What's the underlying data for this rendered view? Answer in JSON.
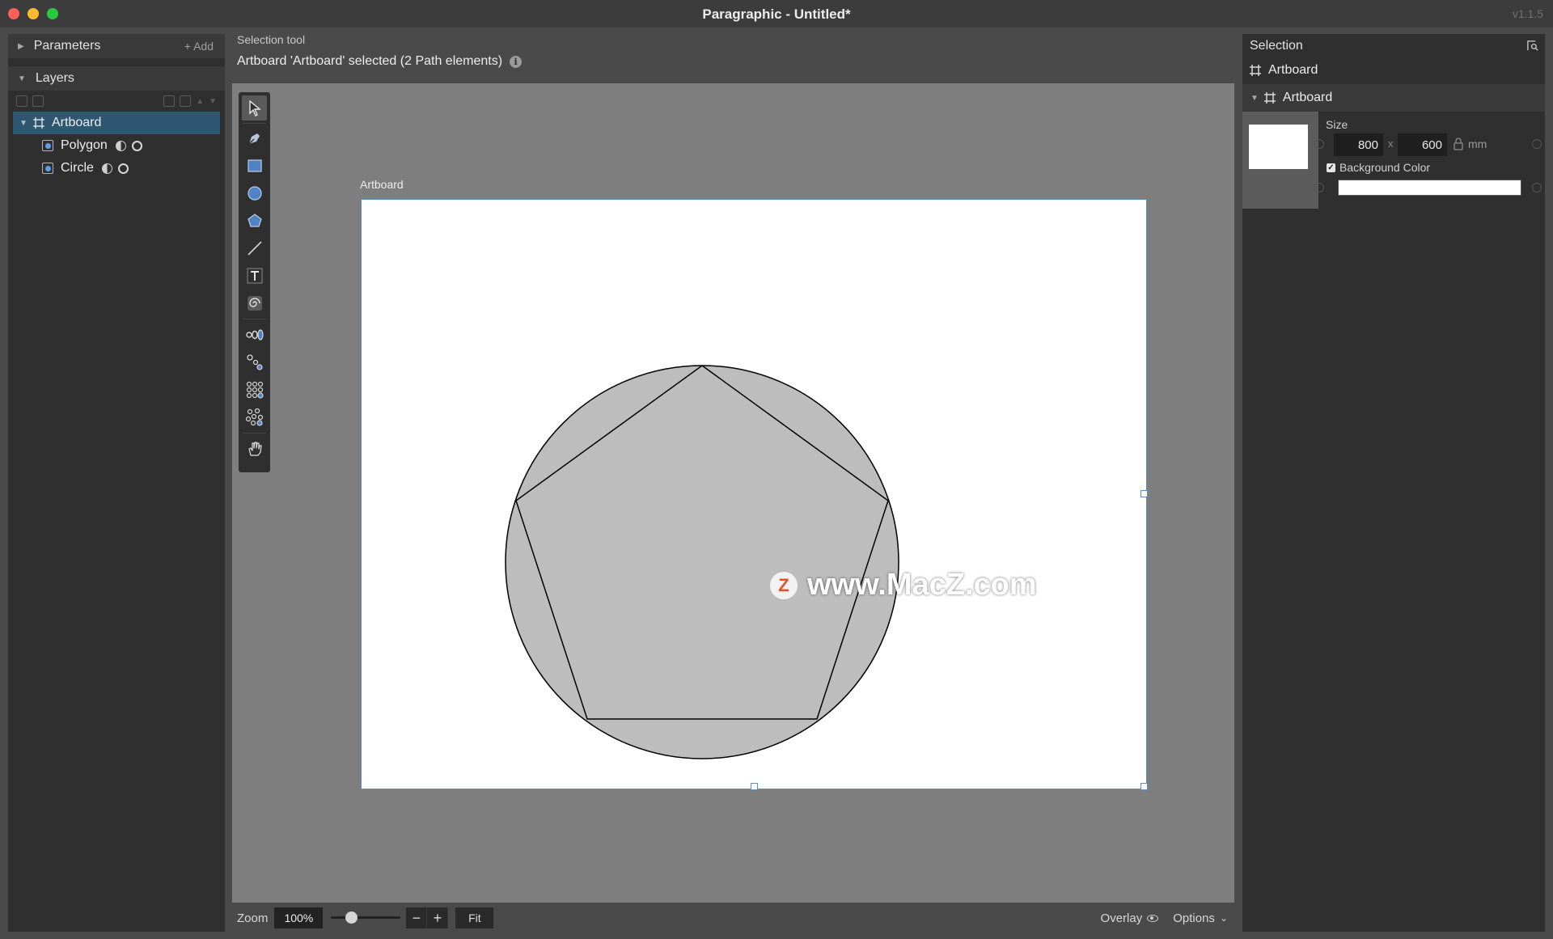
{
  "window": {
    "title": "Paragraphic - Untitled*",
    "version": "v1.1.5"
  },
  "left_panel": {
    "parameters_label": "Parameters",
    "add_label": "+ Add",
    "layers_label": "Layers",
    "layers": [
      {
        "name": "Artboard",
        "type": "artboard",
        "selected": true
      },
      {
        "name": "Polygon",
        "type": "path"
      },
      {
        "name": "Circle",
        "type": "path"
      }
    ]
  },
  "canvas": {
    "tool_hint": "Selection tool",
    "status": "Artboard 'Artboard' selected (2 Path elements)",
    "artboard_label": "Artboard",
    "watermark": "www.MacZ.com",
    "watermark_logo": "Z",
    "shape_fill": "#bdbdbd",
    "shape_stroke": "#000000",
    "tools": [
      "select-tool-icon",
      "pen-tool-icon",
      "rectangle-tool-icon",
      "ellipse-tool-icon",
      "polygon-tool-icon",
      "line-tool-icon",
      "text-tool-icon",
      "spiral-tool-icon",
      "repeat-tool-icon",
      "connect-tool-icon",
      "grid-tool-icon",
      "scatter-tool-icon",
      "hand-tool-icon"
    ]
  },
  "bottom_bar": {
    "zoom_label": "Zoom",
    "zoom_value": "100%",
    "zoom_slider": 0.25,
    "minus": "−",
    "plus": "+",
    "fit": "Fit",
    "overlay": "Overlay",
    "options": "Options"
  },
  "right_panel": {
    "selection_label": "Selection",
    "selected_item": "Artboard",
    "group_label": "Artboard",
    "size_label": "Size",
    "width": "800",
    "x_label": "x",
    "height": "600",
    "unit": "mm",
    "background_label": "Background Color",
    "background_checked": true,
    "background_color": "#ffffff"
  }
}
